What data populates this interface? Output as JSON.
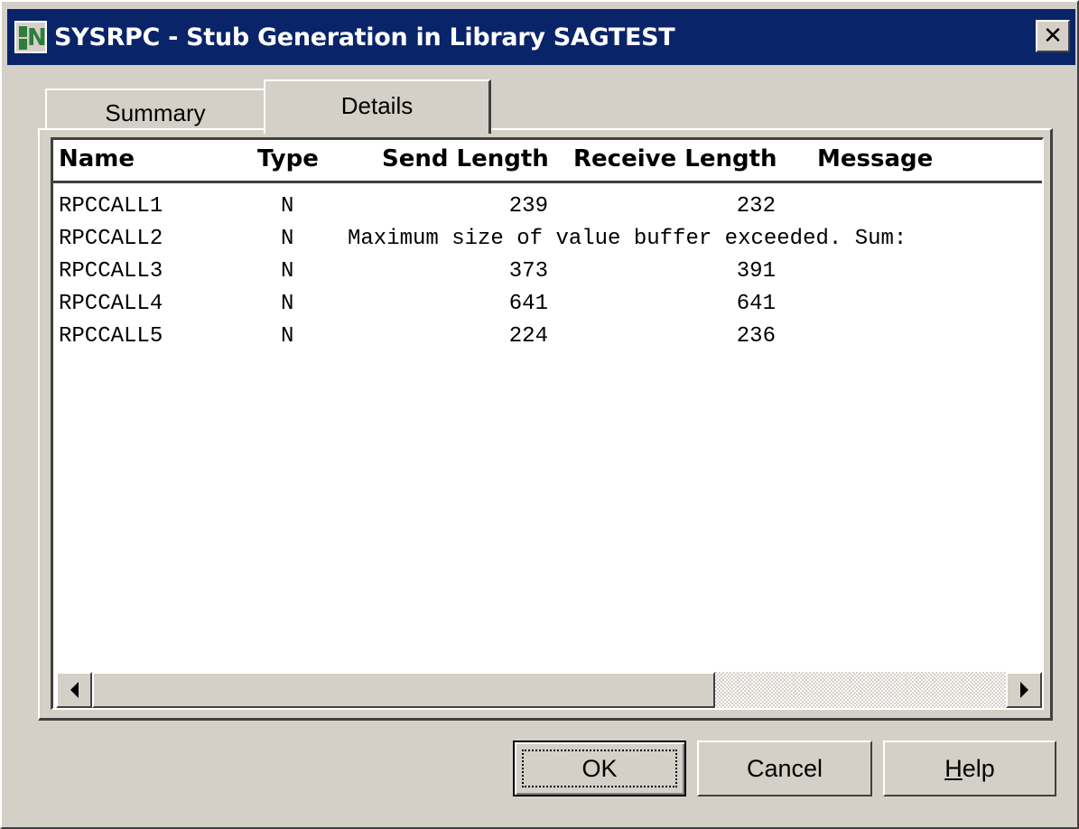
{
  "window": {
    "title": "SYSRPC - Stub Generation in Library SAGTEST",
    "close_label": "✕"
  },
  "tabs": [
    {
      "label": "Summary",
      "selected": false
    },
    {
      "label": "Details",
      "selected": true
    }
  ],
  "table": {
    "columns": [
      "Name",
      "Type",
      "Send Length",
      "Receive Length",
      "Message"
    ],
    "rows": [
      {
        "name": "RPCCALL1",
        "type": "N",
        "send": "239",
        "receive": "232",
        "message": ""
      },
      {
        "name": "RPCCALL2",
        "type": "N",
        "send": "",
        "receive": "",
        "message": "Maximum size of value buffer exceeded. Sum:"
      },
      {
        "name": "RPCCALL3",
        "type": "N",
        "send": "373",
        "receive": "391",
        "message": ""
      },
      {
        "name": "RPCCALL4",
        "type": "N",
        "send": "641",
        "receive": "641",
        "message": ""
      },
      {
        "name": "RPCCALL5",
        "type": "N",
        "send": "224",
        "receive": "236",
        "message": ""
      }
    ]
  },
  "buttons": {
    "ok": "OK",
    "cancel": "Cancel",
    "help_first": "H",
    "help_rest": "elp"
  }
}
